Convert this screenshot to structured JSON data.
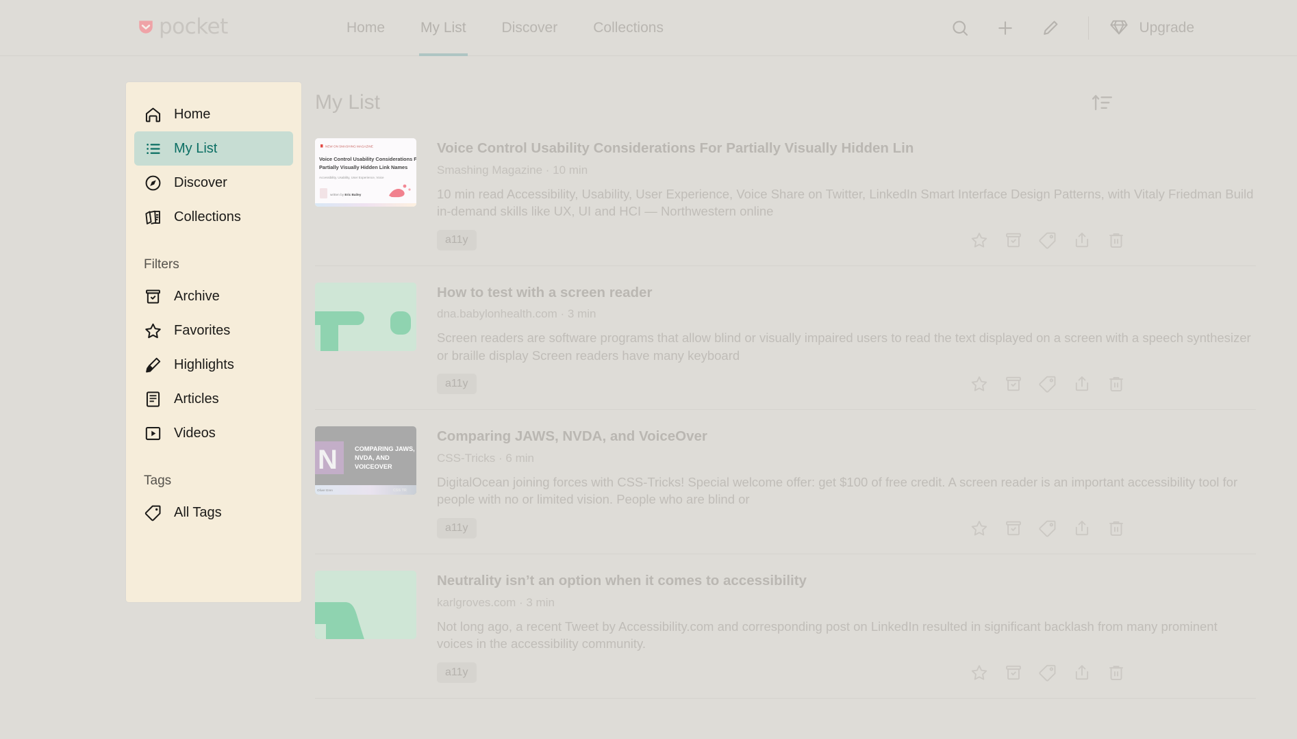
{
  "app": {
    "brand": "pocket",
    "brand_color": "#ef9a9e"
  },
  "header": {
    "nav": [
      {
        "label": "Home",
        "active": false
      },
      {
        "label": "My List",
        "active": true
      },
      {
        "label": "Discover",
        "active": false
      },
      {
        "label": "Collections",
        "active": false
      }
    ],
    "actions": [
      {
        "name": "search-icon",
        "label": "Search"
      },
      {
        "name": "add-icon",
        "label": "Add"
      },
      {
        "name": "edit-icon",
        "label": "Edit"
      }
    ],
    "upgrade_label": "Upgrade",
    "upgrade_icon": "diamond-icon"
  },
  "sidebar": {
    "nav_items": [
      {
        "label": "Home",
        "icon": "home-icon",
        "active": false
      },
      {
        "label": "My List",
        "icon": "list-icon",
        "active": true
      },
      {
        "label": "Discover",
        "icon": "compass-icon",
        "active": false
      },
      {
        "label": "Collections",
        "icon": "collections-icon",
        "active": false
      }
    ],
    "filters_heading": "Filters",
    "filter_items": [
      {
        "label": "Archive",
        "icon": "archive-icon"
      },
      {
        "label": "Favorites",
        "icon": "star-icon"
      },
      {
        "label": "Highlights",
        "icon": "highlighter-icon"
      },
      {
        "label": "Articles",
        "icon": "article-icon"
      },
      {
        "label": "Videos",
        "icon": "video-icon"
      }
    ],
    "tags_heading": "Tags",
    "tag_items": [
      {
        "label": "All Tags",
        "icon": "tag-icon"
      }
    ]
  },
  "main": {
    "title": "My List",
    "sort_icon": "sort-ascending-icon",
    "row_actions": [
      {
        "name": "favorite-icon",
        "label": "Favorite"
      },
      {
        "name": "archive-icon",
        "label": "Archive"
      },
      {
        "name": "tag-icon",
        "label": "Tag"
      },
      {
        "name": "share-icon",
        "label": "Share"
      },
      {
        "name": "delete-icon",
        "label": "Delete"
      }
    ],
    "items": [
      {
        "title": "Voice Control Usability Considerations For Partially Visually Hidden Lin",
        "source": "Smashing Magazine",
        "read_time": "10 min",
        "meta": "Smashing Magazine · 10 min",
        "excerpt": "10 min read Accessibility, Usability, User Experience, Voice Share on Twitter, LinkedIn Smart Interface Design Patterns, with Vitaly Friedman Build in-demand skills like UX, UI and HCI — Northwestern online",
        "tag": "a11y",
        "thumb_style": "smashing-card",
        "thumb_kicker": "NEW ON SMASHING MAGAZINE",
        "thumb_title": "Voice Control Usability Considerations For Partially Visually Hidden Link Names",
        "thumb_sub": "Accessibility, Usability, User Experience, Voice",
        "thumb_byline": "written by Eric Bailey"
      },
      {
        "title": "How to test with a screen reader",
        "source": "dna.babylonhealth.com",
        "read_time": "3 min",
        "meta": "dna.babylonhealth.com · 3 min",
        "excerpt": "Screen readers are software programs that allow blind or visually impaired users to read the text displayed on a screen with a speech synthesizer or braille display Screen readers have many keyboard",
        "tag": "a11y",
        "thumb_style": "mint-tee"
      },
      {
        "title": "Comparing JAWS, NVDA, and VoiceOver",
        "source": "CSS-Tricks",
        "read_time": "6 min",
        "meta": "CSS-Tricks · 6 min",
        "excerpt": "DigitalOcean joining forces with CSS-Tricks! Special welcome offer: get $100 of free credit. A screen reader is an important accessibility tool for people with no or limited vision. People who are blind or",
        "tag": "a11y",
        "thumb_style": "csstricks-card",
        "thumb_title": "COMPARING JAWS, NVDA, AND VOICEOVER",
        "thumb_logo": "N",
        "thumb_byline": "Oliver Eren",
        "thumb_brand": "CSS TR"
      },
      {
        "title": "Neutrality isn’t an option when it comes to accessibility",
        "source": "karlgroves.com",
        "read_time": "3 min",
        "meta": "karlgroves.com · 3 min",
        "excerpt": "Not long ago, a recent Tweet by Accessibility.com and corresponding post on LinkedIn resulted in significant backlash from many prominent voices in the accessibility community.",
        "tag": "a11y",
        "thumb_style": "mint-curve"
      }
    ]
  },
  "colors": {
    "page_bg": "#dedcd7",
    "sidebar_bg": "#f6edda",
    "accent_teal": "#0a6e63",
    "active_pill": "#c7ddd3",
    "tab_underline": "#aec5c3"
  }
}
